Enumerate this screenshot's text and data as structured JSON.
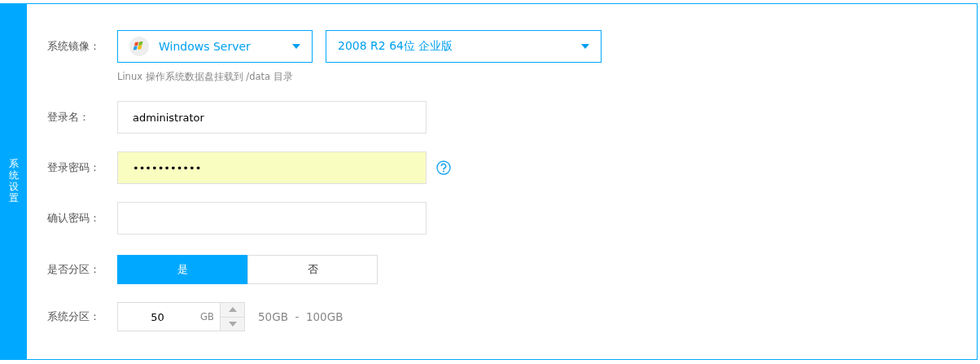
{
  "sidebar_tab": {
    "label": "系统设置"
  },
  "fields": [
    {
      "kind": "image",
      "label": "系统镜像：",
      "os": {
        "value": "Windows Server"
      },
      "version": {
        "value": "2008 R2 64位 企业版"
      },
      "hint": "Linux 操作系统数据盘挂载到 /data 目录"
    },
    {
      "kind": "text",
      "label": "登录名：",
      "value": "administrator",
      "highlighted": false,
      "help": false
    },
    {
      "kind": "text",
      "label": "登录密码：",
      "value": "•••••••••••",
      "highlighted": true,
      "help": true
    },
    {
      "kind": "text",
      "label": "确认密码：",
      "highlighted": false,
      "help": false
    },
    {
      "kind": "toggle",
      "label": "是否分区：",
      "options": [
        {
          "label": "是",
          "selected": true
        },
        {
          "label": "否",
          "selected": false
        }
      ]
    },
    {
      "kind": "number",
      "label": "系统分区：",
      "value": "50",
      "unit": "GB",
      "range": "50GB  -  100GB"
    }
  ]
}
